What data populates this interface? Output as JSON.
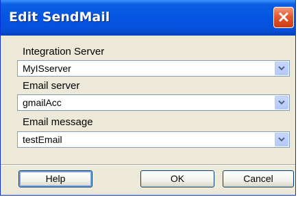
{
  "window": {
    "title": "Edit SendMail"
  },
  "fields": [
    {
      "label": "Integration Server",
      "value": "MyISserver"
    },
    {
      "label": "Email server",
      "value": "gmailAcc"
    },
    {
      "label": "Email message",
      "value": "testEmail"
    }
  ],
  "buttons": {
    "help": "Help",
    "ok": "OK",
    "cancel": "Cancel"
  },
  "icons": {
    "close": "close-icon",
    "dropdown": "chevron-down-icon"
  },
  "colors": {
    "titlebar": "#0554e3",
    "close_button": "#e2582f",
    "dialog_background": "#ece9d8"
  }
}
